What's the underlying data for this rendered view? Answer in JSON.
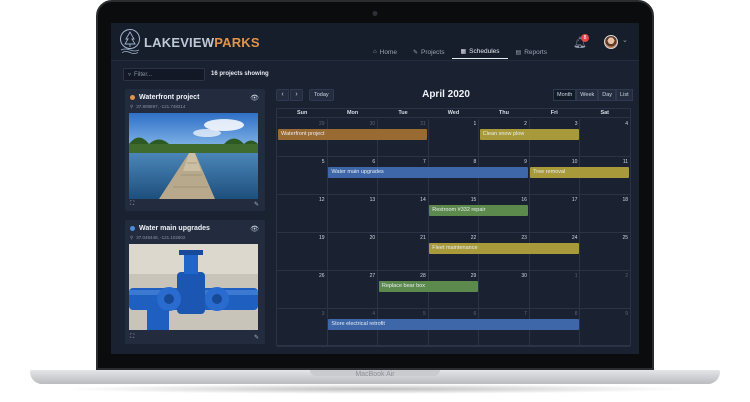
{
  "device_label": "MacBook Air",
  "app": {
    "brand_part1": "LAKEVIEW",
    "brand_part2": "PARKS",
    "brand_color": "#e0954a"
  },
  "nav": [
    {
      "label": "Home",
      "icon": "home-icon",
      "active": false
    },
    {
      "label": "Projects",
      "icon": "wrench-icon",
      "active": false
    },
    {
      "label": "Schedules",
      "icon": "calendar-icon",
      "active": true
    },
    {
      "label": "Reports",
      "icon": "document-icon",
      "active": false
    }
  ],
  "notifications": {
    "count": "8",
    "icon": "bell-icon"
  },
  "filter": {
    "placeholder": "Filter..."
  },
  "projects_showing": "16 projects showing",
  "cards": [
    {
      "title": "Waterfront project",
      "coords": "37.808897, -121.748214",
      "dot_color": "#e0954a"
    },
    {
      "title": "Water main upgrades",
      "coords": "37.048448, -121.102602",
      "dot_color": "#4a8fd8"
    }
  ],
  "calendar": {
    "title": "April 2020",
    "today_label": "Today",
    "views": [
      "Month",
      "Week",
      "Day",
      "List"
    ],
    "active_view": "Month",
    "weekdays": [
      "Sun",
      "Mon",
      "Tue",
      "Wed",
      "Thu",
      "Fri",
      "Sat"
    ],
    "weeks": [
      [
        {
          "n": "29",
          "o": true
        },
        {
          "n": "30",
          "o": true
        },
        {
          "n": "31",
          "o": true
        },
        {
          "n": "1",
          "o": false
        },
        {
          "n": "2",
          "o": false
        },
        {
          "n": "3",
          "o": false
        },
        {
          "n": "4",
          "o": false
        }
      ],
      [
        {
          "n": "5",
          "o": false
        },
        {
          "n": "6",
          "o": false
        },
        {
          "n": "7",
          "o": false
        },
        {
          "n": "8",
          "o": false
        },
        {
          "n": "9",
          "o": false
        },
        {
          "n": "10",
          "o": false
        },
        {
          "n": "11",
          "o": false
        }
      ],
      [
        {
          "n": "12",
          "o": false
        },
        {
          "n": "13",
          "o": false
        },
        {
          "n": "14",
          "o": false
        },
        {
          "n": "15",
          "o": false
        },
        {
          "n": "16",
          "o": false
        },
        {
          "n": "17",
          "o": false
        },
        {
          "n": "18",
          "o": false
        }
      ],
      [
        {
          "n": "19",
          "o": false
        },
        {
          "n": "20",
          "o": false
        },
        {
          "n": "21",
          "o": false
        },
        {
          "n": "22",
          "o": false
        },
        {
          "n": "23",
          "o": false
        },
        {
          "n": "24",
          "o": false
        },
        {
          "n": "25",
          "o": false
        }
      ],
      [
        {
          "n": "26",
          "o": false
        },
        {
          "n": "27",
          "o": false
        },
        {
          "n": "28",
          "o": false
        },
        {
          "n": "29",
          "o": false
        },
        {
          "n": "30",
          "o": false
        },
        {
          "n": "1",
          "o": true
        },
        {
          "n": "2",
          "o": true
        }
      ],
      [
        {
          "n": "3",
          "o": true
        },
        {
          "n": "4",
          "o": true
        },
        {
          "n": "5",
          "o": true
        },
        {
          "n": "6",
          "o": true
        },
        {
          "n": "7",
          "o": true
        },
        {
          "n": "8",
          "o": true
        },
        {
          "n": "9",
          "o": true
        }
      ]
    ],
    "events": [
      {
        "label": "Waterfront project",
        "week": 0,
        "start": 0,
        "span": 3,
        "color": "#9a6a33"
      },
      {
        "label": "Clean snow plow",
        "week": 0,
        "start": 4,
        "span": 2,
        "color": "#a89a3a"
      },
      {
        "label": "Water main upgrades",
        "week": 1,
        "start": 1,
        "span": 4,
        "color": "#3d67a8"
      },
      {
        "label": "Tree removal",
        "week": 1,
        "start": 5,
        "span": 2,
        "color": "#a89a3a"
      },
      {
        "label": "Restroom #332 repair",
        "week": 2,
        "start": 3,
        "span": 2,
        "color": "#5c8a4c"
      },
      {
        "label": "Fleet maintenance",
        "week": 3,
        "start": 3,
        "span": 3,
        "color": "#a89a3a"
      },
      {
        "label": "Replace bear box",
        "week": 4,
        "start": 2,
        "span": 2,
        "color": "#5c8a4c"
      },
      {
        "label": "Store electrical retrofit",
        "week": 5,
        "start": 1,
        "span": 5,
        "color": "#3d67a8"
      }
    ]
  }
}
